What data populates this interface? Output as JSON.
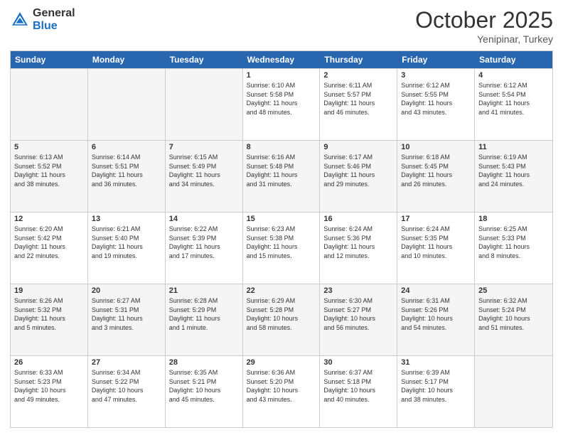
{
  "logo": {
    "general": "General",
    "blue": "Blue"
  },
  "header": {
    "month": "October 2025",
    "location": "Yenipinar, Turkey"
  },
  "weekdays": [
    "Sunday",
    "Monday",
    "Tuesday",
    "Wednesday",
    "Thursday",
    "Friday",
    "Saturday"
  ],
  "rows": [
    [
      {
        "day": "",
        "empty": true
      },
      {
        "day": "",
        "empty": true
      },
      {
        "day": "",
        "empty": true
      },
      {
        "day": "1",
        "line1": "Sunrise: 6:10 AM",
        "line2": "Sunset: 5:58 PM",
        "line3": "Daylight: 11 hours",
        "line4": "and 48 minutes."
      },
      {
        "day": "2",
        "line1": "Sunrise: 6:11 AM",
        "line2": "Sunset: 5:57 PM",
        "line3": "Daylight: 11 hours",
        "line4": "and 46 minutes."
      },
      {
        "day": "3",
        "line1": "Sunrise: 6:12 AM",
        "line2": "Sunset: 5:55 PM",
        "line3": "Daylight: 11 hours",
        "line4": "and 43 minutes."
      },
      {
        "day": "4",
        "line1": "Sunrise: 6:12 AM",
        "line2": "Sunset: 5:54 PM",
        "line3": "Daylight: 11 hours",
        "line4": "and 41 minutes."
      }
    ],
    [
      {
        "day": "5",
        "line1": "Sunrise: 6:13 AM",
        "line2": "Sunset: 5:52 PM",
        "line3": "Daylight: 11 hours",
        "line4": "and 38 minutes."
      },
      {
        "day": "6",
        "line1": "Sunrise: 6:14 AM",
        "line2": "Sunset: 5:51 PM",
        "line3": "Daylight: 11 hours",
        "line4": "and 36 minutes."
      },
      {
        "day": "7",
        "line1": "Sunrise: 6:15 AM",
        "line2": "Sunset: 5:49 PM",
        "line3": "Daylight: 11 hours",
        "line4": "and 34 minutes."
      },
      {
        "day": "8",
        "line1": "Sunrise: 6:16 AM",
        "line2": "Sunset: 5:48 PM",
        "line3": "Daylight: 11 hours",
        "line4": "and 31 minutes."
      },
      {
        "day": "9",
        "line1": "Sunrise: 6:17 AM",
        "line2": "Sunset: 5:46 PM",
        "line3": "Daylight: 11 hours",
        "line4": "and 29 minutes."
      },
      {
        "day": "10",
        "line1": "Sunrise: 6:18 AM",
        "line2": "Sunset: 5:45 PM",
        "line3": "Daylight: 11 hours",
        "line4": "and 26 minutes."
      },
      {
        "day": "11",
        "line1": "Sunrise: 6:19 AM",
        "line2": "Sunset: 5:43 PM",
        "line3": "Daylight: 11 hours",
        "line4": "and 24 minutes."
      }
    ],
    [
      {
        "day": "12",
        "line1": "Sunrise: 6:20 AM",
        "line2": "Sunset: 5:42 PM",
        "line3": "Daylight: 11 hours",
        "line4": "and 22 minutes."
      },
      {
        "day": "13",
        "line1": "Sunrise: 6:21 AM",
        "line2": "Sunset: 5:40 PM",
        "line3": "Daylight: 11 hours",
        "line4": "and 19 minutes."
      },
      {
        "day": "14",
        "line1": "Sunrise: 6:22 AM",
        "line2": "Sunset: 5:39 PM",
        "line3": "Daylight: 11 hours",
        "line4": "and 17 minutes."
      },
      {
        "day": "15",
        "line1": "Sunrise: 6:23 AM",
        "line2": "Sunset: 5:38 PM",
        "line3": "Daylight: 11 hours",
        "line4": "and 15 minutes."
      },
      {
        "day": "16",
        "line1": "Sunrise: 6:24 AM",
        "line2": "Sunset: 5:36 PM",
        "line3": "Daylight: 11 hours",
        "line4": "and 12 minutes."
      },
      {
        "day": "17",
        "line1": "Sunrise: 6:24 AM",
        "line2": "Sunset: 5:35 PM",
        "line3": "Daylight: 11 hours",
        "line4": "and 10 minutes."
      },
      {
        "day": "18",
        "line1": "Sunrise: 6:25 AM",
        "line2": "Sunset: 5:33 PM",
        "line3": "Daylight: 11 hours",
        "line4": "and 8 minutes."
      }
    ],
    [
      {
        "day": "19",
        "line1": "Sunrise: 6:26 AM",
        "line2": "Sunset: 5:32 PM",
        "line3": "Daylight: 11 hours",
        "line4": "and 5 minutes."
      },
      {
        "day": "20",
        "line1": "Sunrise: 6:27 AM",
        "line2": "Sunset: 5:31 PM",
        "line3": "Daylight: 11 hours",
        "line4": "and 3 minutes."
      },
      {
        "day": "21",
        "line1": "Sunrise: 6:28 AM",
        "line2": "Sunset: 5:29 PM",
        "line3": "Daylight: 11 hours",
        "line4": "and 1 minute."
      },
      {
        "day": "22",
        "line1": "Sunrise: 6:29 AM",
        "line2": "Sunset: 5:28 PM",
        "line3": "Daylight: 10 hours",
        "line4": "and 58 minutes."
      },
      {
        "day": "23",
        "line1": "Sunrise: 6:30 AM",
        "line2": "Sunset: 5:27 PM",
        "line3": "Daylight: 10 hours",
        "line4": "and 56 minutes."
      },
      {
        "day": "24",
        "line1": "Sunrise: 6:31 AM",
        "line2": "Sunset: 5:26 PM",
        "line3": "Daylight: 10 hours",
        "line4": "and 54 minutes."
      },
      {
        "day": "25",
        "line1": "Sunrise: 6:32 AM",
        "line2": "Sunset: 5:24 PM",
        "line3": "Daylight: 10 hours",
        "line4": "and 51 minutes."
      }
    ],
    [
      {
        "day": "26",
        "line1": "Sunrise: 6:33 AM",
        "line2": "Sunset: 5:23 PM",
        "line3": "Daylight: 10 hours",
        "line4": "and 49 minutes."
      },
      {
        "day": "27",
        "line1": "Sunrise: 6:34 AM",
        "line2": "Sunset: 5:22 PM",
        "line3": "Daylight: 10 hours",
        "line4": "and 47 minutes."
      },
      {
        "day": "28",
        "line1": "Sunrise: 6:35 AM",
        "line2": "Sunset: 5:21 PM",
        "line3": "Daylight: 10 hours",
        "line4": "and 45 minutes."
      },
      {
        "day": "29",
        "line1": "Sunrise: 6:36 AM",
        "line2": "Sunset: 5:20 PM",
        "line3": "Daylight: 10 hours",
        "line4": "and 43 minutes."
      },
      {
        "day": "30",
        "line1": "Sunrise: 6:37 AM",
        "line2": "Sunset: 5:18 PM",
        "line3": "Daylight: 10 hours",
        "line4": "and 40 minutes."
      },
      {
        "day": "31",
        "line1": "Sunrise: 6:39 AM",
        "line2": "Sunset: 5:17 PM",
        "line3": "Daylight: 10 hours",
        "line4": "and 38 minutes."
      },
      {
        "day": "",
        "empty": true
      }
    ]
  ]
}
